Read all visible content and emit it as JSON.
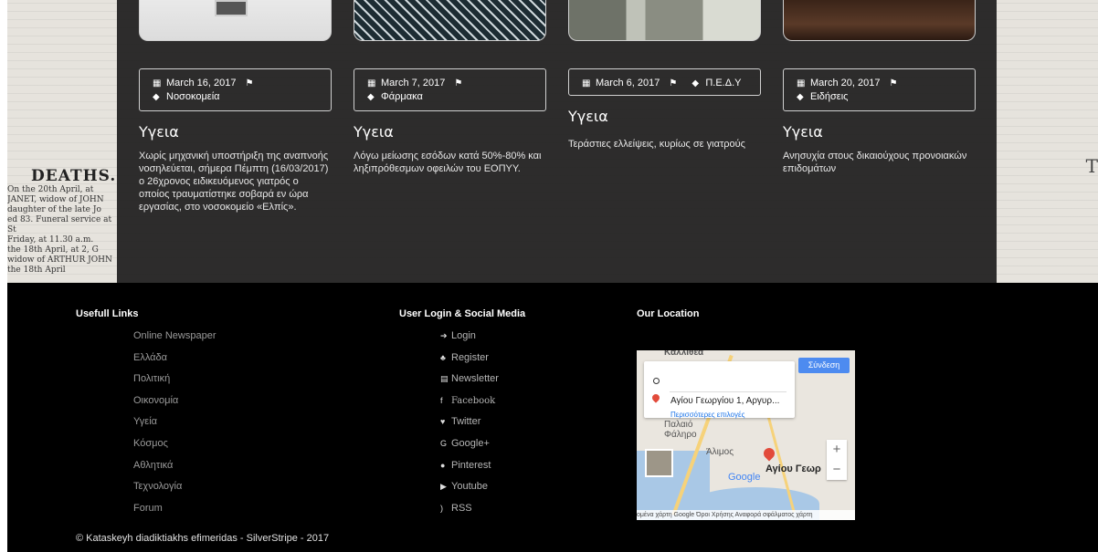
{
  "background": {
    "deaths_heading": "DEATHS.",
    "old_print_lines": [
      "On the 20th April, at",
      "JANET, widow of JOHN",
      "daughter of the late Jo",
      "ed 83. Funeral service at St",
      "Friday, at 11.30 a.m.",
      "the 18th April, at 2, G",
      "widow of ARTHUR JOHN",
      "the 18th April"
    ],
    "right_letter": "T"
  },
  "articles": [
    {
      "date": "March 16, 2017",
      "category": "Νοσοκομεία",
      "title": "Υγεια",
      "excerpt": "Χωρίς μηχανική υποστήριξη της αναπνοής νοσηλεύεται, σήμερα Πέμπτη (16/03/2017) ο 26χρονος ειδικευόμενος γιατρός ο οποίος τραυματίστηκε σοβαρά εν ώρα εργασίας, στο νοσοκομείο «Ελπίς»."
    },
    {
      "date": "March 7, 2017",
      "category": "Φάρμακα",
      "title": "Υγεια",
      "excerpt": "Λόγω μείωσης εσόδων κατά 50%-80% και ληξιπρόθεσμων οφειλών του ΕΟΠΥΥ."
    },
    {
      "date": "March 6, 2017",
      "category": "Π.Ε.Δ.Υ",
      "title": "Υγεια",
      "excerpt": "Τεράστιες ελλείψεις, κυρίως σε γιατρούς"
    },
    {
      "date": "March 20, 2017",
      "category": "Ειδήσεις",
      "title": "Υγεια",
      "excerpt": "Ανησυχία στους δικαιούχους προνοιακών επιδομάτων"
    }
  ],
  "footer": {
    "useful_links_title": "Usefull Links",
    "useful_links": [
      "Online Newspaper",
      "Ελλάδα",
      "Πολιτική",
      "Οικονομία",
      "Υγεία",
      "Κόσμος",
      "Αθλητικά",
      "Τεχνολογία",
      "Forum"
    ],
    "social_title": "User Login & Social Media",
    "social_links": [
      {
        "icon": "login-icon",
        "label": "Login"
      },
      {
        "icon": "register-icon",
        "label": "Register"
      },
      {
        "icon": "newsletter-icon",
        "label": "Newsletter"
      },
      {
        "icon": "facebook-icon",
        "label": "Facebook"
      },
      {
        "icon": "twitter-icon",
        "label": "Twitter"
      },
      {
        "icon": "google-plus-icon",
        "label": "Google+"
      },
      {
        "icon": "pinterest-icon",
        "label": "Pinterest"
      },
      {
        "icon": "youtube-icon",
        "label": "Youtube"
      },
      {
        "icon": "rss-icon",
        "label": "RSS"
      }
    ],
    "location_title": "Our Location",
    "copyright": "© Kataskeyh diadiktiakhs efimeridas - SilverStripe - 2017"
  },
  "map": {
    "sign_in": "Σύνδεση",
    "address": "Αγίου Γεωργίου 1, Αργυρ...",
    "more_options": "Περισσότερες επιλογές",
    "place_label": "Αγίου Γεωρ",
    "area_labels": [
      "Παλαιό Φάληρο",
      "Άλιμος",
      "Καλλιθέα"
    ],
    "google": "Google",
    "attribution": "ομένα χάρτη Google   Όροι Χρήσης   Αναφορά σφάλματος χάρτη",
    "zoom_in": "+",
    "zoom_out": "−"
  },
  "colors": {
    "panel": "#1e1e1e",
    "footer": "#000000",
    "link": "#9a9a9a"
  }
}
